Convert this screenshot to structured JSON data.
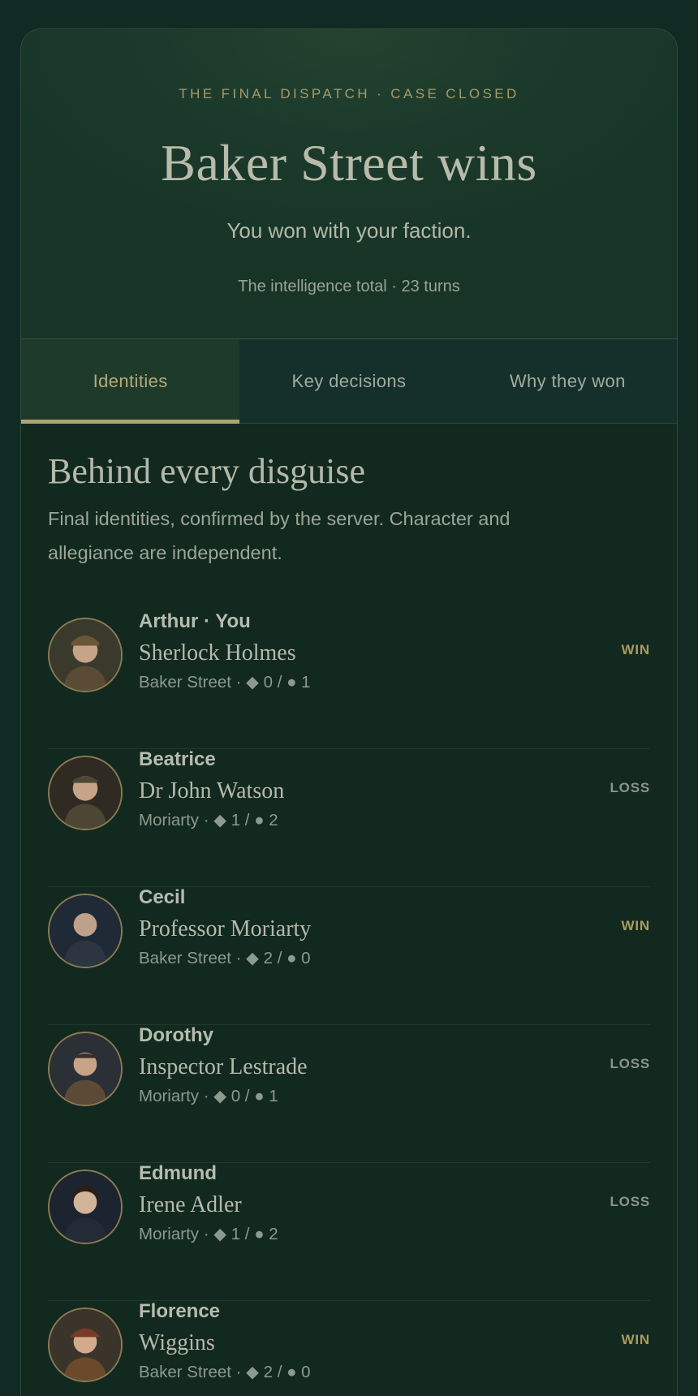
{
  "header": {
    "eyebrow": "THE FINAL DISPATCH · CASE CLOSED",
    "title": "Baker Street wins",
    "subtitle": "You won with your faction.",
    "meta": "The intelligence total · 23 turns"
  },
  "tabs": [
    {
      "label": "Identities",
      "active": true
    },
    {
      "label": "Key decisions",
      "active": false
    },
    {
      "label": "Why they won",
      "active": false
    }
  ],
  "section": {
    "title": "Behind every disguise",
    "description": "Final identities, confirmed by the server. Character and allegiance are independent."
  },
  "players": [
    {
      "player": "Arthur · You",
      "character": "Sherlock Holmes",
      "allegiance": "Baker Street · ◆ 0 / ● 1",
      "result": "WIN",
      "avatar_color": "#5b4a34"
    },
    {
      "player": "Beatrice",
      "character": "Dr John Watson",
      "allegiance": "Moriarty · ◆ 1 / ● 2",
      "result": "LOSS",
      "avatar_color": "#4d4632"
    },
    {
      "player": "Cecil",
      "character": "Professor Moriarty",
      "allegiance": "Baker Street · ◆ 2 / ● 0",
      "result": "WIN",
      "avatar_color": "#2c3540"
    },
    {
      "player": "Dorothy",
      "character": "Inspector Lestrade",
      "allegiance": "Moriarty · ◆ 0 / ● 1",
      "result": "LOSS",
      "avatar_color": "#3e3a30"
    },
    {
      "player": "Edmund",
      "character": "Irene Adler",
      "allegiance": "Moriarty · ◆ 1 / ● 2",
      "result": "LOSS",
      "avatar_color": "#232b36"
    },
    {
      "player": "Florence",
      "character": "Wiggins",
      "allegiance": "Baker Street · ◆ 2 / ● 0",
      "result": "WIN",
      "avatar_color": "#4a3a2c"
    }
  ]
}
